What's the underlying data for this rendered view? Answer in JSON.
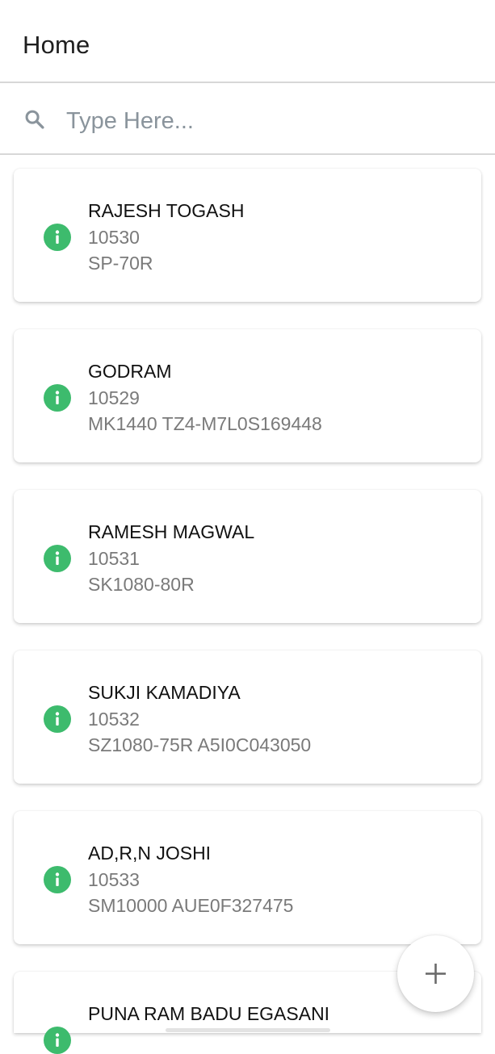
{
  "header": {
    "title": "Home"
  },
  "search": {
    "placeholder": "Type Here...",
    "value": ""
  },
  "items": [
    {
      "name": "RAJESH TOGASH",
      "code": "10530",
      "model": "SP-70R",
      "icon": "info-icon"
    },
    {
      "name": "GODRAM",
      "code": "10529",
      "model": "MK1440 TZ4-M7L0S169448",
      "icon": "info-icon"
    },
    {
      "name": "RAMESH MAGWAL",
      "code": "10531",
      "model": "SK1080-80R",
      "icon": "info-icon"
    },
    {
      "name": "SUKJI KAMADIYA",
      "code": "10532",
      "model": "SZ1080-75R A5I0C043050",
      "icon": "info-icon"
    },
    {
      "name": "AD,R,N JOSHI",
      "code": "10533",
      "model": "SM10000 AUE0F327475",
      "icon": "info-icon"
    },
    {
      "name": "PUNA RAM BADU EGASANI",
      "code": "",
      "model": "",
      "icon": "info-icon"
    }
  ],
  "fab": {
    "icon": "plus-icon"
  },
  "colors": {
    "accent": "#3dbb6d",
    "text_secondary": "#7a7a7a",
    "placeholder": "#8a949c"
  }
}
